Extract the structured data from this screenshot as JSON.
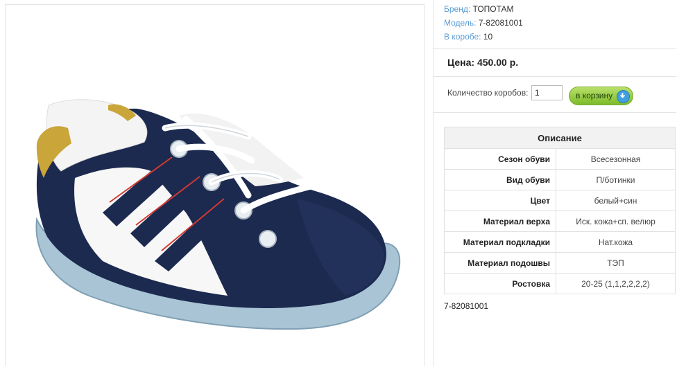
{
  "product": {
    "image_alt": "shoe-photo",
    "brand_label": "Бренд:",
    "brand_value": "ТОПОТАМ",
    "model_label": "Модель:",
    "model_value": "7-82081001",
    "box_label": "В коробе:",
    "box_value": "10",
    "price_text": "Цена: 450.00 р.",
    "quantity_label": "Количество коробов:",
    "quantity_value": "1",
    "cart_button_label": "в корзину",
    "footer_code": "7-82081001"
  },
  "description": {
    "header": "Описание",
    "rows": [
      {
        "name": "Сезон обуви",
        "value": "Всесезонная"
      },
      {
        "name": "Вид обуви",
        "value": "П/ботинки"
      },
      {
        "name": "Цвет",
        "value": "белый+син"
      },
      {
        "name": "Материал верха",
        "value": "Иск. кожа+сп. велюр"
      },
      {
        "name": "Материал подкладки",
        "value": "Нат.кожа"
      },
      {
        "name": "Материал подошвы",
        "value": "ТЭП"
      },
      {
        "name": "Ростовка",
        "value": "20-25 (1,1,2,2,2,2)"
      }
    ]
  },
  "colors": {
    "label_blue": "#5b9bd5",
    "button_green": "#8cc63f",
    "shoe_navy": "#1c2a4f"
  }
}
